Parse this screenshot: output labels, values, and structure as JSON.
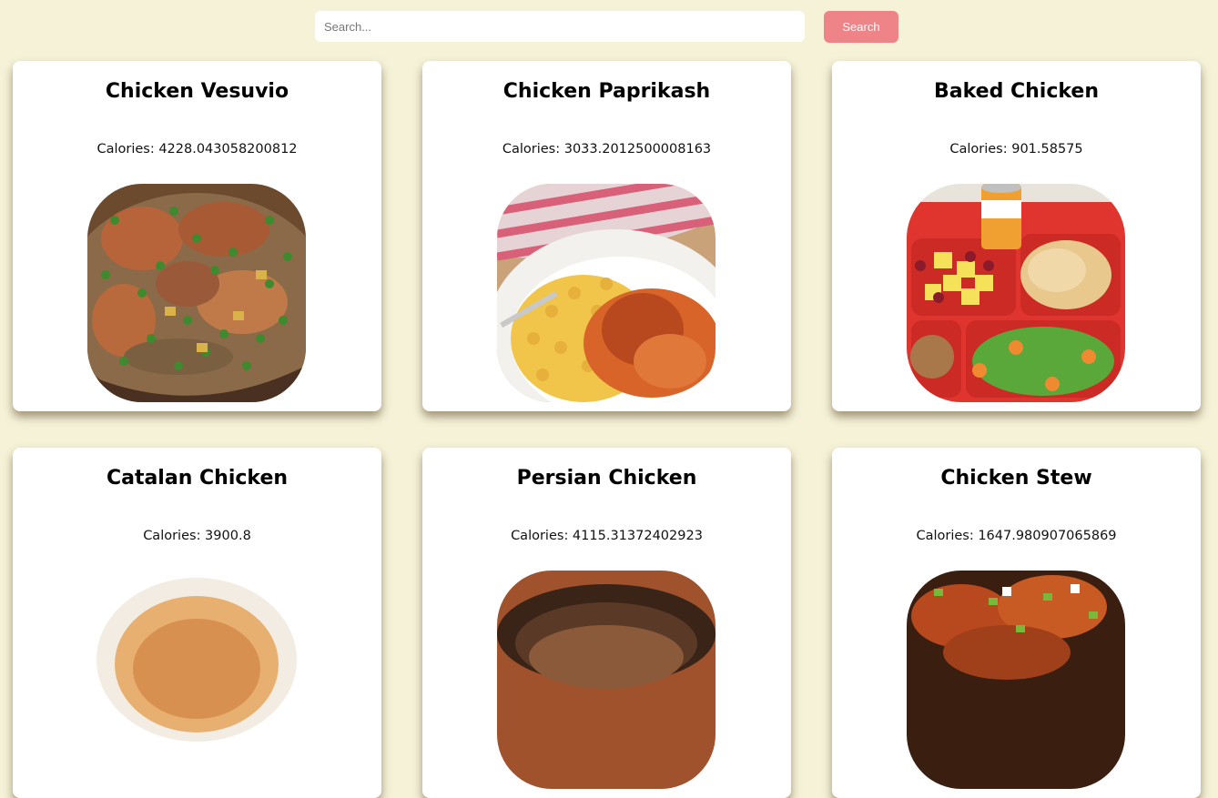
{
  "search": {
    "placeholder": "Search...",
    "button_label": "Search"
  },
  "recipes": [
    {
      "title": "Chicken Vesuvio",
      "calories_label": "Calories: 4228.043058200812",
      "image": "chicken-vesuvio-photo"
    },
    {
      "title": "Chicken Paprikash",
      "calories_label": "Calories: 3033.2012500008163",
      "image": "chicken-paprikash-photo"
    },
    {
      "title": "Baked Chicken",
      "calories_label": "Calories: 901.58575",
      "image": "baked-chicken-photo"
    },
    {
      "title": "Catalan Chicken",
      "calories_label": "Calories: 3900.8",
      "image": "catalan-chicken-photo"
    },
    {
      "title": "Persian Chicken",
      "calories_label": "Calories: 4115.31372402923",
      "image": "persian-chicken-photo"
    },
    {
      "title": "Chicken Stew",
      "calories_label": "Calories: 1647.980907065869",
      "image": "chicken-stew-photo"
    }
  ],
  "colors": {
    "page_background": "#f5f2d8",
    "search_button": "#ef8488",
    "card_background": "#ffffff"
  }
}
